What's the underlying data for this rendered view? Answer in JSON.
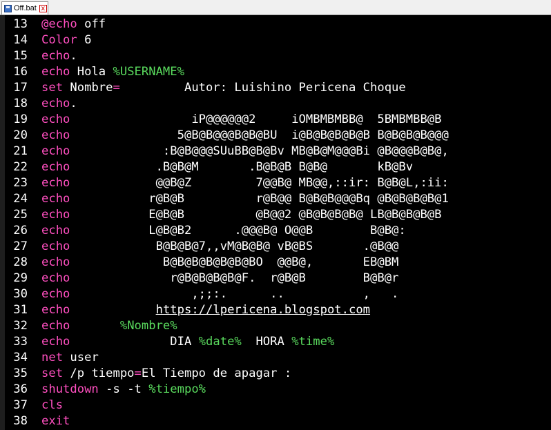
{
  "tab": {
    "title": "Off.bat",
    "close_glyph": "x"
  },
  "colors": {
    "keyword": "#ff4fc0",
    "variable": "#59d95d",
    "text": "#ffffff",
    "background": "#000000"
  },
  "lines": [
    {
      "num": "13",
      "tokens": [
        {
          "t": "@echo",
          "c": "kw"
        },
        {
          "t": " off"
        }
      ]
    },
    {
      "num": "14",
      "tokens": [
        {
          "t": "Color",
          "c": "kw"
        },
        {
          "t": " 6"
        }
      ]
    },
    {
      "num": "15",
      "tokens": [
        {
          "t": "echo",
          "c": "kw"
        },
        {
          "t": "."
        }
      ]
    },
    {
      "num": "16",
      "tokens": [
        {
          "t": "echo",
          "c": "kw"
        },
        {
          "t": " Hola "
        },
        {
          "t": "%USERNAME%",
          "c": "var"
        }
      ]
    },
    {
      "num": "17",
      "tokens": [
        {
          "t": "set",
          "c": "kw"
        },
        {
          "t": " Nombre"
        },
        {
          "t": "=",
          "c": "kw"
        },
        {
          "t": "         Autor: Luishino Pericena Choque"
        }
      ]
    },
    {
      "num": "18",
      "tokens": [
        {
          "t": "echo",
          "c": "kw"
        },
        {
          "t": "."
        }
      ]
    },
    {
      "num": "19",
      "tokens": [
        {
          "t": "echo",
          "c": "kw"
        },
        {
          "t": "                 iP@@@@@@2     iOMBMBMBB@  5BMBMBB@B"
        }
      ]
    },
    {
      "num": "20",
      "tokens": [
        {
          "t": "echo",
          "c": "kw"
        },
        {
          "t": "               5@B@B@@@B@B@BU  i@B@B@B@B@B B@B@B@B@@@"
        }
      ]
    },
    {
      "num": "21",
      "tokens": [
        {
          "t": "echo",
          "c": "kw"
        },
        {
          "t": "             :B@B@@@SUuBB@B@Bv MB@B@M@@@Bi @B@@@B@B@,"
        }
      ]
    },
    {
      "num": "22",
      "tokens": [
        {
          "t": "echo",
          "c": "kw"
        },
        {
          "t": "            .B@B@M       .B@B@B B@B@       kB@Bv"
        }
      ]
    },
    {
      "num": "23",
      "tokens": [
        {
          "t": "echo",
          "c": "kw"
        },
        {
          "t": "            @@B@Z         7@@B@ MB@@,::ir: B@B@L,:ii:"
        }
      ]
    },
    {
      "num": "24",
      "tokens": [
        {
          "t": "echo",
          "c": "kw"
        },
        {
          "t": "           r@B@B          r@B@@ B@B@B@@@Bq @B@B@B@B@1"
        }
      ]
    },
    {
      "num": "25",
      "tokens": [
        {
          "t": "echo",
          "c": "kw"
        },
        {
          "t": "           E@B@B          @B@@2 @B@B@B@B@ LB@B@B@B@B"
        }
      ]
    },
    {
      "num": "26",
      "tokens": [
        {
          "t": "echo",
          "c": "kw"
        },
        {
          "t": "           L@B@B2      .@@@B@ O@@B        B@B@:"
        }
      ]
    },
    {
      "num": "27",
      "tokens": [
        {
          "t": "echo",
          "c": "kw"
        },
        {
          "t": "            B@B@B@7,,vM@B@B@ vB@BS       .@B@@"
        }
      ]
    },
    {
      "num": "28",
      "tokens": [
        {
          "t": "echo",
          "c": "kw"
        },
        {
          "t": "             B@B@B@B@B@B@BO  @@B@,       EB@BM"
        }
      ]
    },
    {
      "num": "29",
      "tokens": [
        {
          "t": "echo",
          "c": "kw"
        },
        {
          "t": "              r@B@B@B@B@F.  r@B@B        B@B@r"
        }
      ]
    },
    {
      "num": "30",
      "tokens": [
        {
          "t": "echo",
          "c": "kw"
        },
        {
          "t": "                 ,;;:.      ..           ,   ."
        }
      ]
    },
    {
      "num": "31",
      "tokens": [
        {
          "t": "echo",
          "c": "kw"
        },
        {
          "t": "            "
        },
        {
          "t": "https://lpericena.blogspot.com",
          "c": "link"
        }
      ]
    },
    {
      "num": "32",
      "tokens": [
        {
          "t": "echo",
          "c": "kw"
        },
        {
          "t": "       "
        },
        {
          "t": "%Nombre%",
          "c": "var"
        }
      ]
    },
    {
      "num": "33",
      "tokens": [
        {
          "t": "echo",
          "c": "kw"
        },
        {
          "t": "              DIA "
        },
        {
          "t": "%date%",
          "c": "var"
        },
        {
          "t": "  HORA "
        },
        {
          "t": "%time%",
          "c": "var"
        }
      ]
    },
    {
      "num": "34",
      "tokens": [
        {
          "t": "net",
          "c": "kw"
        },
        {
          "t": " user"
        }
      ]
    },
    {
      "num": "35",
      "tokens": [
        {
          "t": "set",
          "c": "kw"
        },
        {
          "t": " /p tiempo"
        },
        {
          "t": "=",
          "c": "kw"
        },
        {
          "t": "El Tiempo de apagar :"
        }
      ]
    },
    {
      "num": "36",
      "tokens": [
        {
          "t": "shutdown",
          "c": "kw"
        },
        {
          "t": " -s -t "
        },
        {
          "t": "%tiempo%",
          "c": "var"
        }
      ]
    },
    {
      "num": "37",
      "tokens": [
        {
          "t": "cls",
          "c": "kw"
        }
      ]
    },
    {
      "num": "38",
      "tokens": [
        {
          "t": "exit",
          "c": "kw"
        }
      ]
    }
  ]
}
